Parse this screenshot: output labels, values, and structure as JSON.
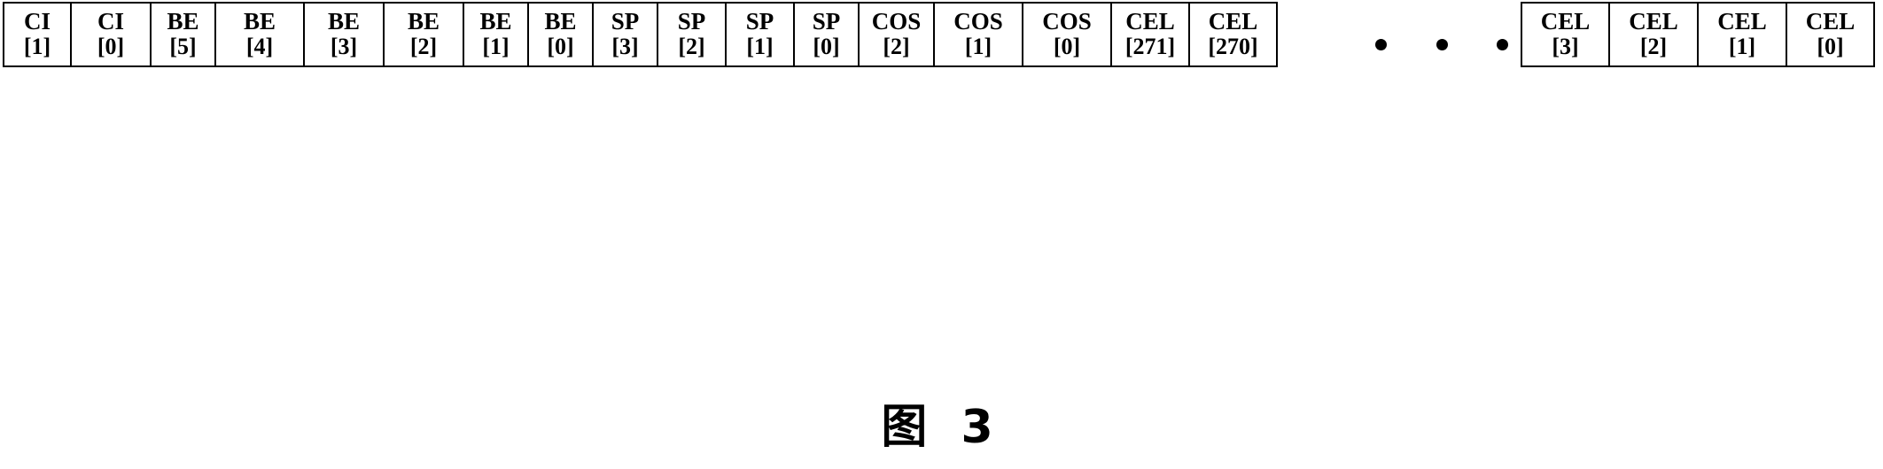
{
  "figure": {
    "caption": "图 3",
    "ellipsis_dots": 3
  },
  "groups": [
    {
      "id": "left",
      "cells": [
        {
          "name": "CI",
          "index": "[1]"
        },
        {
          "name": "CI",
          "index": "[0]"
        },
        {
          "name": "BE",
          "index": "[5]"
        },
        {
          "name": "BE",
          "index": "[4]"
        },
        {
          "name": "BE",
          "index": "[3]"
        },
        {
          "name": "BE",
          "index": "[2]"
        },
        {
          "name": "BE",
          "index": "[1]"
        },
        {
          "name": "BE",
          "index": "[0]"
        },
        {
          "name": "SP",
          "index": "[3]"
        },
        {
          "name": "SP",
          "index": "[2]"
        },
        {
          "name": "SP",
          "index": "[1]"
        },
        {
          "name": "SP",
          "index": "[0]"
        },
        {
          "name": "COS",
          "index": "[2]"
        },
        {
          "name": "COS",
          "index": "[1]"
        },
        {
          "name": "COS",
          "index": "[0]"
        },
        {
          "name": "CEL",
          "index": "[271]"
        },
        {
          "name": "CEL",
          "index": "[270]"
        }
      ]
    },
    {
      "id": "right",
      "cells": [
        {
          "name": "CEL",
          "index": "[3]"
        },
        {
          "name": "CEL",
          "index": "[2]"
        },
        {
          "name": "CEL",
          "index": "[1]"
        },
        {
          "name": "CEL",
          "index": "[0]"
        }
      ]
    }
  ],
  "colors": {
    "border": "#000000",
    "text": "#000000",
    "background": "#ffffff"
  }
}
